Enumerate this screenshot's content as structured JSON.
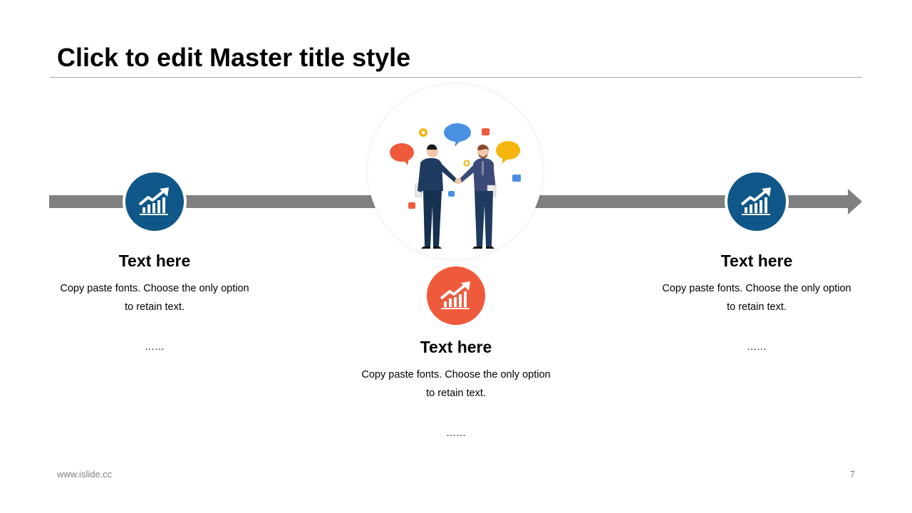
{
  "slide": {
    "title": "Click to edit Master title style",
    "footer_url": "www.islide.cc",
    "page_number": "7"
  },
  "blocks": [
    {
      "heading": "Text here",
      "body_line1": "Copy paste fonts. Choose the only option",
      "body_line2": "to retain text.",
      "dots": "……",
      "icon": "growth-chart-icon",
      "icon_color": "#0F5788"
    },
    {
      "heading": "Text here",
      "body_line1": "Copy paste fonts. Choose the only option",
      "body_line2": "to retain text.",
      "dots": "……",
      "icon": "growth-chart-icon",
      "icon_color": "#F05A3C"
    },
    {
      "heading": "Text here",
      "body_line1": "Copy paste fonts. Choose the only option",
      "body_line2": "to retain text.",
      "dots": "……",
      "icon": "growth-chart-icon",
      "icon_color": "#0F5788"
    }
  ],
  "center_illustration": "handshake-illustration",
  "colors": {
    "arrow": "#808080",
    "primary_blue": "#0F5788",
    "accent_orange": "#F05A3C",
    "rule": "#A6A6A6"
  }
}
